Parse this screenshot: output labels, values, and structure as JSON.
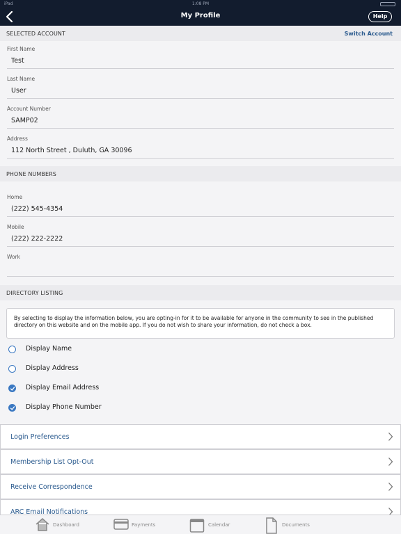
{
  "status_bar": {
    "left": "iPad",
    "time": "1:08 PM"
  },
  "nav": {
    "title": "My Profile",
    "help_label": "Help"
  },
  "selected_account": {
    "header": "SELECTED ACCOUNT",
    "switch_label": "Switch Account",
    "fields": [
      {
        "label": "First Name",
        "value": "Test"
      },
      {
        "label": "Last Name",
        "value": "User"
      },
      {
        "label": "Account Number",
        "value": "SAMP02"
      },
      {
        "label": "Address",
        "value": "112  North Street , Duluth, GA 30096"
      }
    ]
  },
  "phone_numbers": {
    "header": "PHONE NUMBERS",
    "fields": [
      {
        "label": "Home",
        "value": "(222) 545-4354"
      },
      {
        "label": "Mobile",
        "value": "(222) 222-2222"
      },
      {
        "label": "Work",
        "value": ""
      }
    ]
  },
  "directory_listing": {
    "header": "DIRECTORY LISTING",
    "notice": "By selecting to display the information below, you are opting-in for it to be available for anyone in the community to see in the published directory on this website and on the mobile app. If you do not wish to share your information, do not check a box.",
    "options": [
      {
        "label": "Display Name",
        "checked": false
      },
      {
        "label": "Display Address",
        "checked": false
      },
      {
        "label": "Display Email Address",
        "checked": true
      },
      {
        "label": "Display Phone Number",
        "checked": true
      }
    ]
  },
  "menu": [
    {
      "label": "Login Preferences"
    },
    {
      "label": "Membership List Opt-Out"
    },
    {
      "label": "Receive Correspondence"
    },
    {
      "label": "ARC Email Notifications"
    }
  ],
  "tabs": [
    {
      "label": "Dashboard",
      "icon": "home-icon"
    },
    {
      "label": "Payments",
      "icon": "credit-card-icon"
    },
    {
      "label": "Calendar",
      "icon": "calendar-icon"
    },
    {
      "label": "Documents",
      "icon": "document-icon"
    }
  ],
  "colors": {
    "navbar": "#121c2e",
    "accent": "#3a78c2",
    "link": "#2a5a8e"
  }
}
